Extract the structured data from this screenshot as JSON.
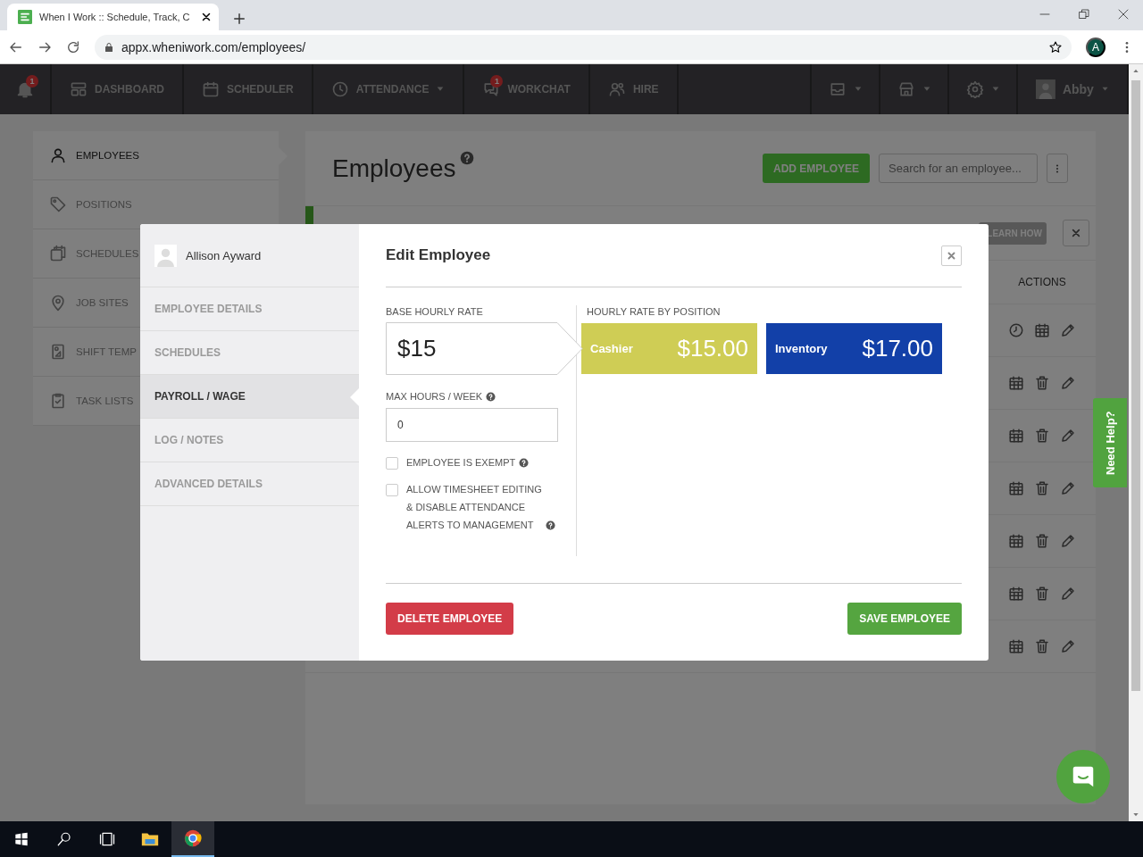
{
  "browser": {
    "tab_title": "When I Work :: Schedule, Track, C",
    "url": "appx.wheniwork.com/employees/",
    "profile": "A"
  },
  "nav": {
    "notifications_badge": "1",
    "items": [
      {
        "label": "DASHBOARD",
        "kind": "dashboard"
      },
      {
        "label": "SCHEDULER",
        "kind": "scheduler"
      },
      {
        "label": "ATTENDANCE",
        "kind": "attendance",
        "dropdown": true
      },
      {
        "label": "WORKCHAT",
        "kind": "chat",
        "badge": "1"
      },
      {
        "label": "HIRE",
        "kind": "hire"
      }
    ],
    "menus": [
      {
        "kind": "inbox"
      },
      {
        "kind": "store"
      },
      {
        "kind": "settings"
      }
    ],
    "user": "Abby"
  },
  "sidebar": {
    "items": [
      {
        "label": "EMPLOYEES",
        "kind": "person",
        "selected": true
      },
      {
        "label": "POSITIONS",
        "kind": "tag",
        "selected": false
      },
      {
        "label": "SCHEDULES",
        "kind": "schedules",
        "selected": false
      },
      {
        "label": "JOB SITES",
        "kind": "pin",
        "selected": false
      },
      {
        "label": "SHIFT TEMP",
        "kind": "template",
        "selected": false
      },
      {
        "label": "TASK LISTS",
        "kind": "tasks",
        "selected": false
      }
    ]
  },
  "page": {
    "title": "Employees",
    "add_button": "ADD EMPLOYEE",
    "search": {
      "placeholder": "Search for an employee..."
    },
    "learn_how": "LEARN HOW",
    "actions_header": "ACTIONS",
    "rows": [
      {
        "actions": [
          {
            "kind": "clock"
          },
          {
            "kind": "calendar"
          },
          {
            "kind": "edit"
          }
        ]
      },
      {
        "actions": [
          {
            "kind": "calendar"
          },
          {
            "kind": "delete"
          },
          {
            "kind": "edit"
          }
        ]
      },
      {
        "actions": [
          {
            "kind": "calendar"
          },
          {
            "kind": "delete"
          },
          {
            "kind": "edit"
          }
        ]
      },
      {
        "actions": [
          {
            "kind": "calendar"
          },
          {
            "kind": "delete"
          },
          {
            "kind": "edit"
          }
        ]
      },
      {
        "actions": [
          {
            "kind": "calendar"
          },
          {
            "kind": "delete"
          },
          {
            "kind": "edit"
          }
        ]
      },
      {
        "actions": [
          {
            "kind": "calendar"
          },
          {
            "kind": "delete"
          },
          {
            "kind": "edit"
          }
        ]
      },
      {
        "actions": [
          {
            "kind": "calendar"
          },
          {
            "kind": "delete"
          },
          {
            "kind": "edit"
          }
        ]
      }
    ]
  },
  "modal": {
    "employee_name": "Allison Ayward",
    "menu": [
      {
        "label": "EMPLOYEE DETAILS",
        "selected": false
      },
      {
        "label": "SCHEDULES",
        "selected": false
      },
      {
        "label": "PAYROLL / WAGE",
        "selected": true
      },
      {
        "label": "LOG / NOTES",
        "selected": false
      },
      {
        "label": "ADVANCED DETAILS",
        "selected": false
      }
    ],
    "title": "Edit Employee",
    "base_rate": {
      "label": "BASE HOURLY RATE",
      "value": "$15"
    },
    "max_hours": {
      "label": "MAX HOURS / WEEK",
      "value": "0"
    },
    "checkboxes": [
      {
        "label": "EMPLOYEE IS EXEMPT",
        "checked": false
      },
      {
        "label": "ALLOW TIMESHEET EDITING & DISABLE ATTENDANCE ALERTS TO MANAGEMENT",
        "checked": false
      }
    ],
    "rates_title": "HOURLY RATE BY POSITION",
    "positions": [
      {
        "name": "Cashier",
        "rate": "$15.00",
        "color": "#cfcd55"
      },
      {
        "name": "Inventory",
        "rate": "$17.00",
        "color": "#1240a8"
      }
    ],
    "delete_button": "DELETE EMPLOYEE",
    "save_button": "SAVE EMPLOYEE"
  },
  "need_help": "Need Help?",
  "taskbar": {
    "apps": [
      {
        "kind": "files",
        "selected": false
      },
      {
        "kind": "browser",
        "selected": true
      }
    ]
  }
}
